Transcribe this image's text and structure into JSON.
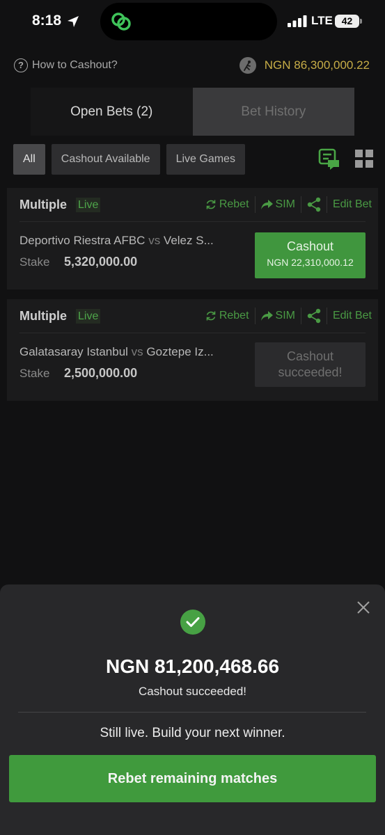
{
  "status_bar": {
    "time": "8:18",
    "network": "LTE",
    "battery": "42"
  },
  "header": {
    "how_to_label": "How to Cashout?",
    "balance": "NGN 86,300,000.22"
  },
  "tabs": [
    {
      "label": "Open Bets (2)",
      "active": true
    },
    {
      "label": "Bet History",
      "active": false
    }
  ],
  "filters": [
    {
      "label": "All",
      "active": true
    },
    {
      "label": "Cashout Available",
      "active": false
    },
    {
      "label": "Live Games",
      "active": false
    }
  ],
  "bets": [
    {
      "type": "Multiple",
      "live": "Live",
      "actions": {
        "rebet": "Rebet",
        "sim": "SIM",
        "edit": "Edit Bet"
      },
      "home": "Deportivo Riestra AFBC",
      "vs": "vs",
      "away": "Velez S...",
      "stake_label": "Stake",
      "stake": "5,320,000.00",
      "cashout_label": "Cashout",
      "cashout_amount": "NGN 22,310,000.12"
    },
    {
      "type": "Multiple",
      "live": "Live",
      "actions": {
        "rebet": "Rebet",
        "sim": "SIM",
        "edit": "Edit Bet"
      },
      "home": "Galatasaray Istanbul",
      "vs": "vs",
      "away": "Goztepe Iz...",
      "stake_label": "Stake",
      "stake": "2,500,000.00",
      "cashout_line1": "Cashout",
      "cashout_line2": "succeeded!"
    }
  ],
  "sheet": {
    "amount": "NGN 81,200,468.66",
    "status": "Cashout succeeded!",
    "tagline": "Still live. Build your next winner.",
    "button": "Rebet remaining matches"
  },
  "colors": {
    "accent_green": "#409a3d",
    "gold": "#c7ad47",
    "background": "#111112"
  }
}
